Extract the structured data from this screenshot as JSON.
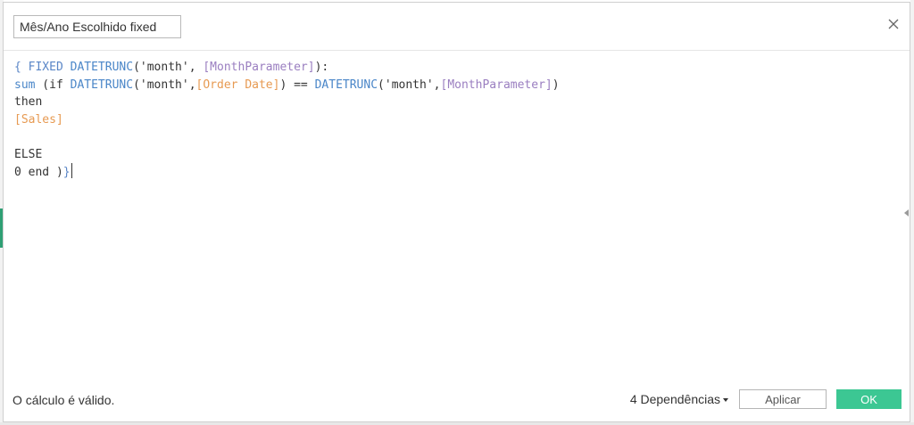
{
  "dialog": {
    "name_field_value": "Mês/Ano Escolhido fixed",
    "close_icon": "close-icon"
  },
  "editor": {
    "lines": [
      [
        {
          "t": "{ ",
          "c": "kw"
        },
        {
          "t": "FIXED",
          "c": "kw"
        },
        {
          "t": " ",
          "c": "text"
        },
        {
          "t": "DATETRUNC",
          "c": "fn"
        },
        {
          "t": "('month', ",
          "c": "text"
        },
        {
          "t": "[MonthParameter]",
          "c": "param"
        },
        {
          "t": "):",
          "c": "text"
        }
      ],
      [
        {
          "t": "sum",
          "c": "fn"
        },
        {
          "t": " (if ",
          "c": "text"
        },
        {
          "t": "DATETRUNC",
          "c": "fn"
        },
        {
          "t": "('month',",
          "c": "text"
        },
        {
          "t": "[Order Date]",
          "c": "field"
        },
        {
          "t": ") == ",
          "c": "text"
        },
        {
          "t": "DATETRUNC",
          "c": "fn"
        },
        {
          "t": "('month',",
          "c": "text"
        },
        {
          "t": "[MonthParameter]",
          "c": "param"
        },
        {
          "t": ")",
          "c": "text"
        }
      ],
      [
        {
          "t": "then",
          "c": "text"
        }
      ],
      [
        {
          "t": "[Sales]",
          "c": "field"
        }
      ],
      [],
      [
        {
          "t": "ELSE",
          "c": "text"
        }
      ],
      [
        {
          "t": "0 end )",
          "c": "text"
        },
        {
          "t": "}",
          "c": "brace-hl"
        },
        {
          "t": "",
          "c": "caret"
        }
      ]
    ]
  },
  "footer": {
    "status": "O cálculo é válido.",
    "dependencies_label": "4 Dependências",
    "apply_label": "Aplicar",
    "ok_label": "OK"
  },
  "colors": {
    "ok_button": "#3cc793",
    "keyword": "#5a86c7",
    "parameter": "#9a7ec0",
    "field": "#e79a52"
  }
}
